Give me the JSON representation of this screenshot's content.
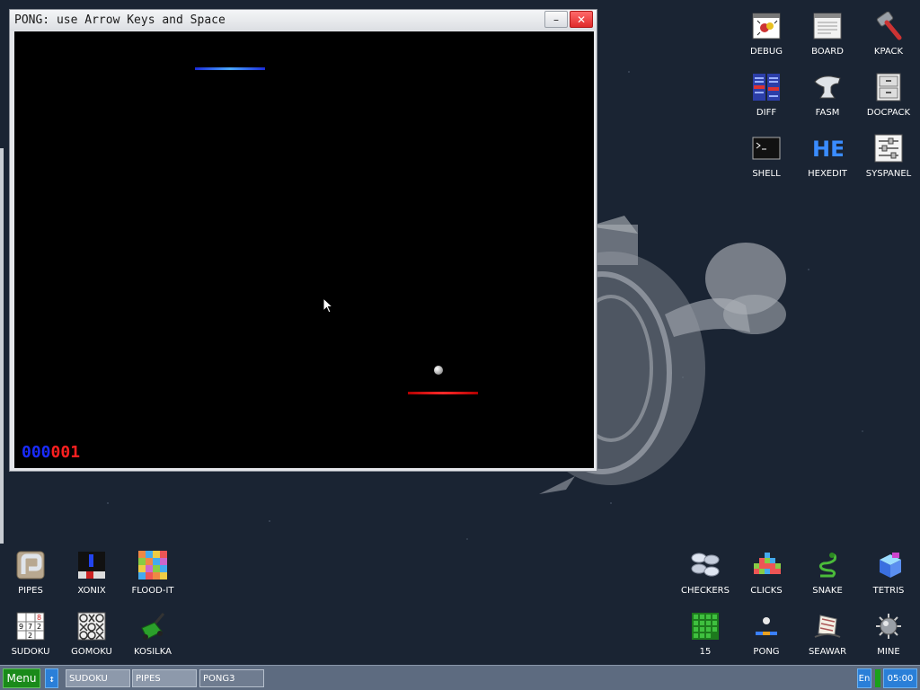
{
  "window": {
    "title": "PONG: use Arrow Keys and Space",
    "minimize": "–",
    "close": "✕"
  },
  "game": {
    "score_blue": "000",
    "score_red": "001"
  },
  "desktop_icons_top": [
    {
      "label": "DEBUG",
      "icon": "debug-bug-icon"
    },
    {
      "label": "BOARD",
      "icon": "board-icon"
    },
    {
      "label": "KPACK",
      "icon": "hammer-icon"
    },
    {
      "label": "DIFF",
      "icon": "diff-icon"
    },
    {
      "label": "FASM",
      "icon": "anvil-icon"
    },
    {
      "label": "DOCPACK",
      "icon": "cabinet-icon"
    },
    {
      "label": "SHELL",
      "icon": "terminal-icon"
    },
    {
      "label": "HEXEDIT",
      "icon": "hex-editor-icon"
    },
    {
      "label": "SYSPANEL",
      "icon": "sliders-icon"
    }
  ],
  "desktop_icons_bottom": [
    {
      "label": "PIPES",
      "icon": "pipes-icon"
    },
    {
      "label": "XONIX",
      "icon": "xonix-icon"
    },
    {
      "label": "FLOOD-IT",
      "icon": "flood-it-icon"
    },
    {
      "label": "SUDOKU",
      "icon": "sudoku-icon"
    },
    {
      "label": "GOMOKU",
      "icon": "gomoku-icon"
    },
    {
      "label": "KOSILKA",
      "icon": "lawnmower-icon"
    },
    {
      "label": "CHECKERS",
      "icon": "checkers-icon"
    },
    {
      "label": "CLICKS",
      "icon": "clicks-icon"
    },
    {
      "label": "SNAKE",
      "icon": "snake-icon"
    },
    {
      "label": "TETRIS",
      "icon": "tetris-icon"
    },
    {
      "label": "15",
      "icon": "fifteen-puzzle-icon"
    },
    {
      "label": "PONG",
      "icon": "pong-icon"
    },
    {
      "label": "SEAWAR",
      "icon": "seawar-icon"
    },
    {
      "label": "MINE",
      "icon": "mine-icon"
    }
  ],
  "taskbar": {
    "menu": "Menu",
    "swap": "↕",
    "tasks": [
      "SUDOKU",
      "PIPES",
      "PONG3"
    ],
    "lang": "En",
    "clock": "05:00"
  },
  "colors": {
    "desktop": "#1a2433",
    "taskbar": "#5d6b80",
    "menu_green": "#1a8a1a",
    "tray_blue": "#2a7fd8",
    "score_blue": "#1a2bff",
    "score_red": "#ff2020"
  }
}
